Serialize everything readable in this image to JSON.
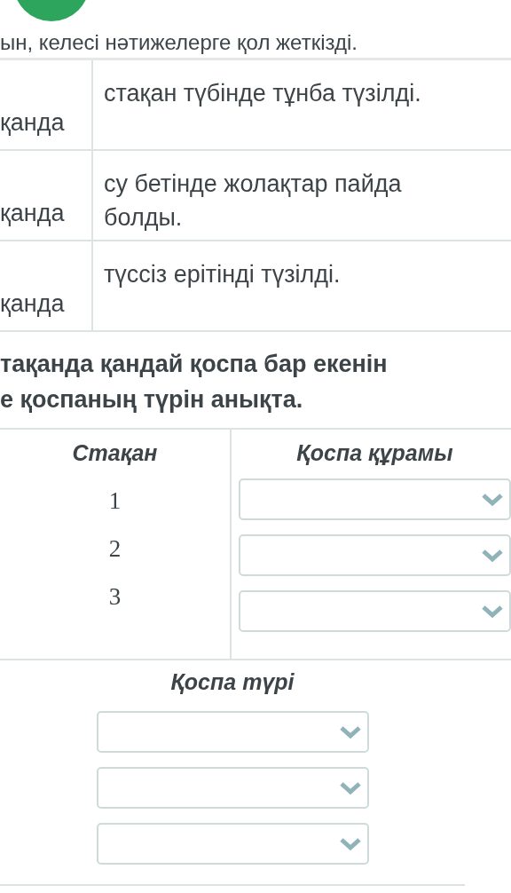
{
  "intro_text": "ын, келесі нәтижелерге қол жеткізді.",
  "observations": [
    {
      "glass": "қанда",
      "result": "стақан түбінде тұнба түзілді."
    },
    {
      "glass": "қанда",
      "result": "су бетінде жолақтар пайда болды."
    },
    {
      "glass": "қанда",
      "result": "түссіз ерітінді түзілді."
    }
  ],
  "question": [
    "тақанда қандай қоспа бар екенін",
    "е қоспаның түрін анықта."
  ],
  "composition_table": {
    "columns": [
      "Стақан",
      "Қоспа құрамы"
    ],
    "rows": [
      {
        "glass": "1",
        "select": {
          "kind": "dropdown"
        }
      },
      {
        "glass": "2",
        "select": {
          "kind": "dropdown"
        }
      },
      {
        "glass": "3",
        "select": {
          "kind": "dropdown"
        }
      }
    ]
  },
  "mixture_type": {
    "heading": "Қоспа түрі",
    "selects": [
      {
        "kind": "dropdown"
      },
      {
        "kind": "dropdown"
      },
      {
        "kind": "dropdown"
      }
    ]
  }
}
